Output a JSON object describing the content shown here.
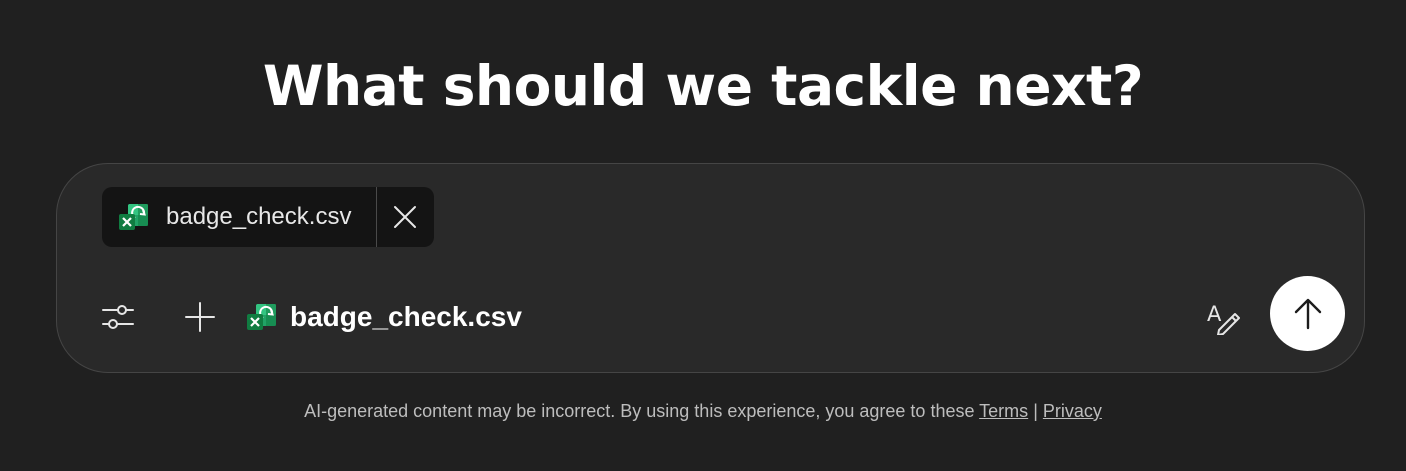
{
  "heading": "What should we tackle next?",
  "attachment_chip": {
    "file_name": "badge_check.csv",
    "file_icon": "excel-icon",
    "remove_icon": "close-icon"
  },
  "toolbar": {
    "tools_icon": "sliders-icon",
    "add_icon": "plus-icon",
    "attached_file_name": "badge_check.csv",
    "rewrite_icon": "rewrite-pen-icon",
    "send_icon": "arrow-up-icon"
  },
  "footer": {
    "disclaimer": "AI-generated content may be incorrect. By using this experience, you agree to these",
    "terms_label": "Terms",
    "separator": "|",
    "privacy_label": "Privacy"
  },
  "colors": {
    "background": "#202020",
    "composer_background": "#292929",
    "chip_background": "#141414",
    "excel_green": "#107C41",
    "send_button": "#ffffff"
  }
}
